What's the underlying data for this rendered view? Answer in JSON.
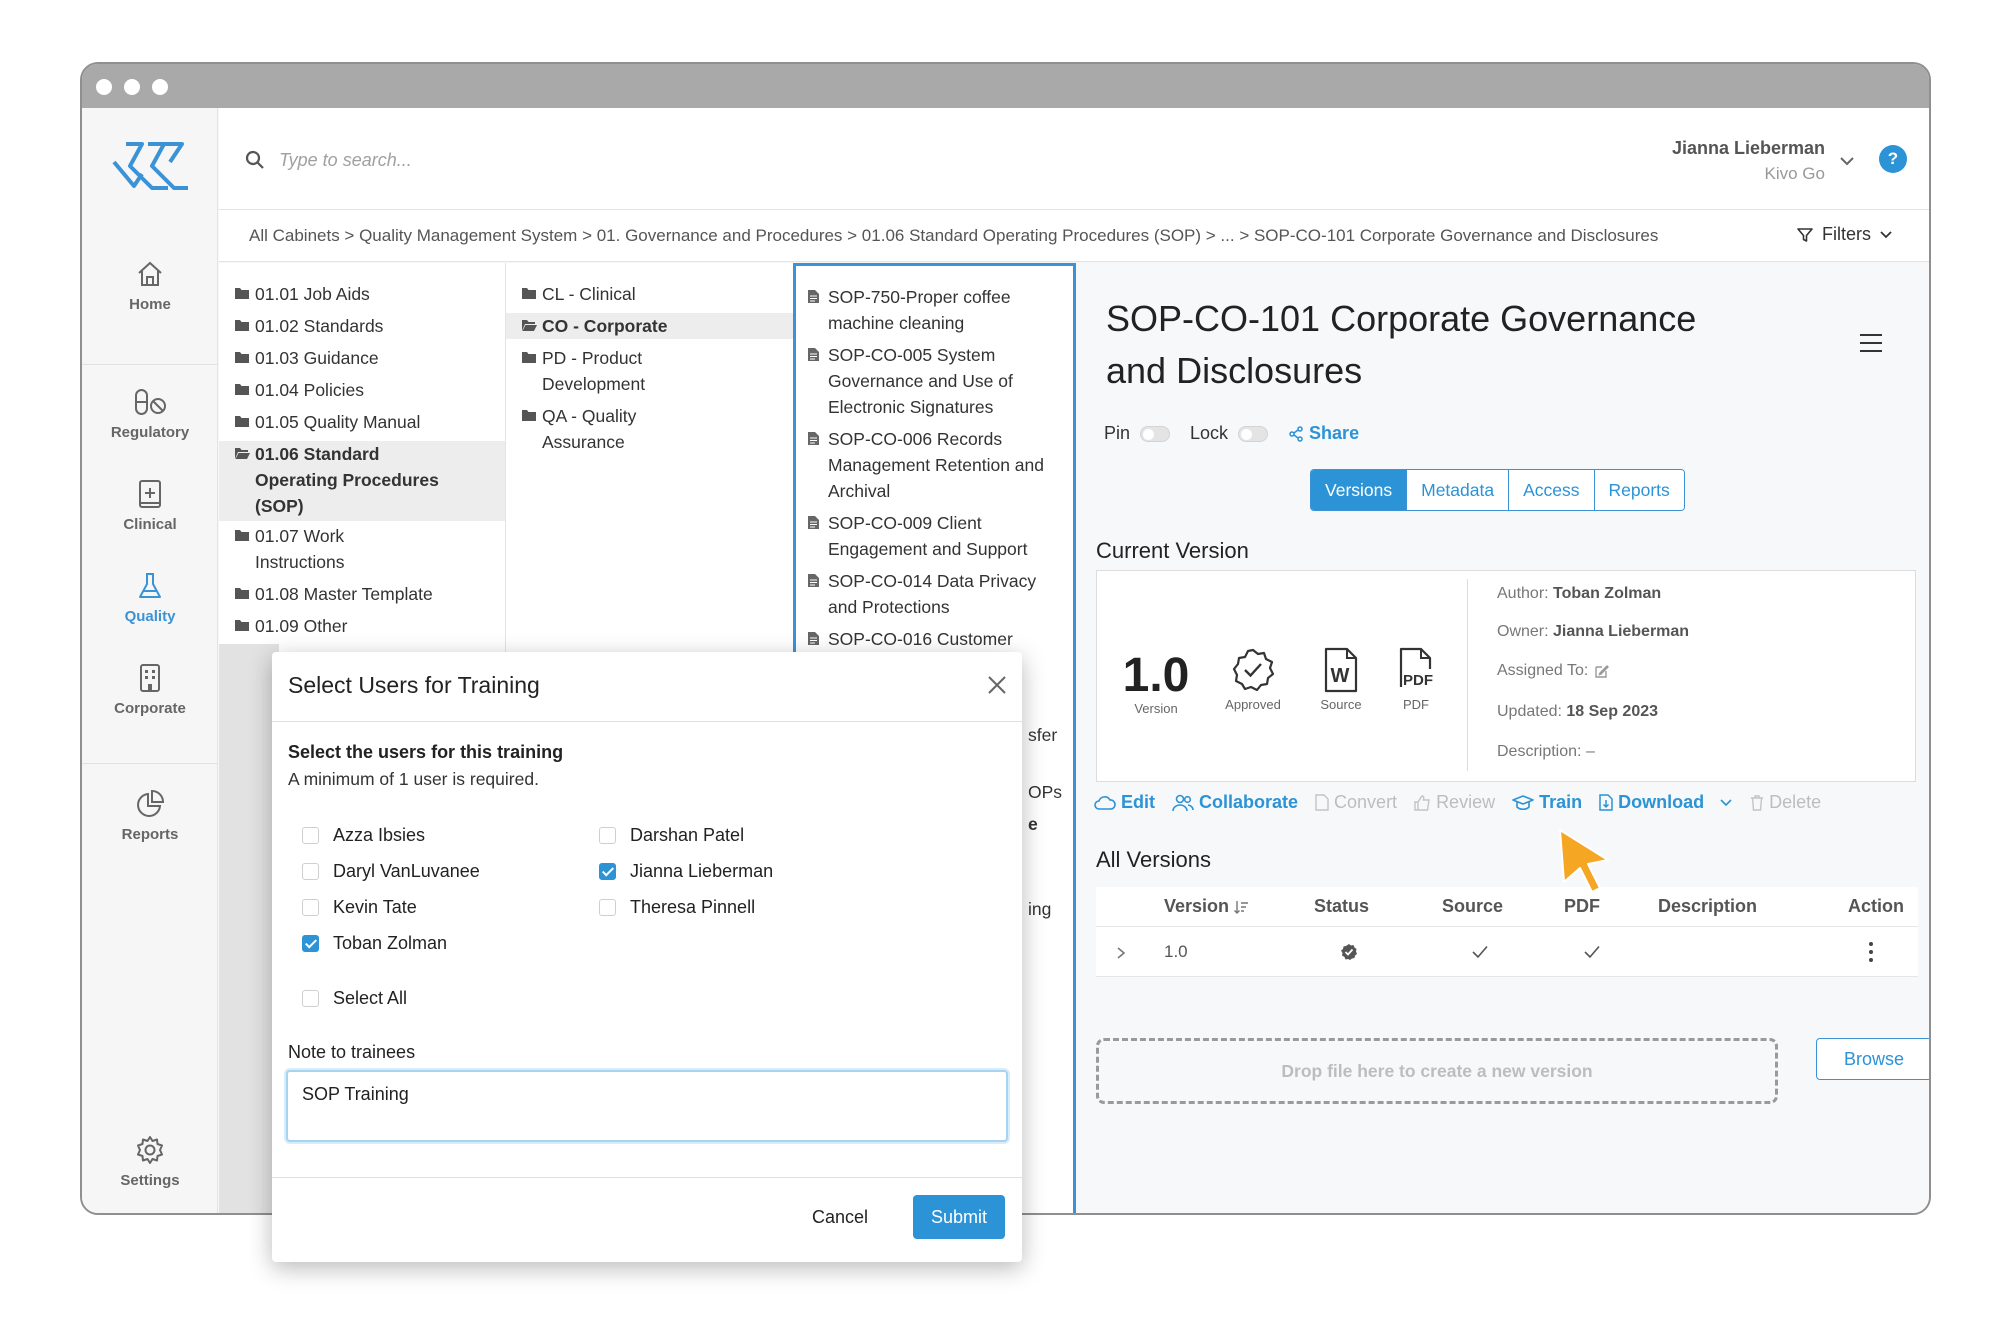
{
  "search": {
    "placeholder": "Type to search..."
  },
  "user": {
    "name": "Jianna Lieberman",
    "org": "Kivo Go",
    "help": "?"
  },
  "sidebar": {
    "items": [
      {
        "label": "Home"
      },
      {
        "label": "Regulatory"
      },
      {
        "label": "Clinical"
      },
      {
        "label": "Quality"
      },
      {
        "label": "Corporate"
      },
      {
        "label": "Reports"
      },
      {
        "label": "Settings"
      }
    ]
  },
  "breadcrumb": "All Cabinets > Quality Management System > 01. Governance and Procedures > 01.06 Standard Operating Procedures (SOP) > ... > SOP-CO-101 Corporate Governance and Disclosures",
  "filters_label": "Filters",
  "col1": [
    {
      "label": "01.01 Job Aids"
    },
    {
      "label": "01.02 Standards"
    },
    {
      "label": "01.03 Guidance"
    },
    {
      "label": "01.04 Policies"
    },
    {
      "label": "01.05 Quality Manual"
    },
    {
      "label": "01.06 Standard Operating Procedures (SOP)"
    },
    {
      "label": "01.07 Work Instructions"
    },
    {
      "label": "01.08 Master Template"
    },
    {
      "label": "01.09 Other"
    }
  ],
  "col2": [
    {
      "label": "CL - Clinical"
    },
    {
      "label": "CO - Corporate"
    },
    {
      "label": "PD - Product Development"
    },
    {
      "label": "QA - Quality Assurance"
    }
  ],
  "col3": [
    {
      "label": "SOP-750-Proper coffee machine cleaning"
    },
    {
      "label": "SOP-CO-005 System Governance and Use of Electronic Signatures"
    },
    {
      "label": "SOP-CO-006 Records Management Retention and Archival"
    },
    {
      "label": "SOP-CO-009 Client Engagement and Support"
    },
    {
      "label": "SOP-CO-014 Data Privacy and Protections"
    },
    {
      "label": "SOP-CO-016 Customer"
    }
  ],
  "col3_fragments": [
    "sfer",
    "OPs",
    "e",
    "ing"
  ],
  "doc": {
    "title": "SOP-CO-101 Corporate Governance and Disclosures",
    "pin_label": "Pin",
    "lock_label": "Lock",
    "share_label": "Share",
    "tabs": [
      {
        "label": "Versions"
      },
      {
        "label": "Metadata"
      },
      {
        "label": "Access"
      },
      {
        "label": "Reports"
      }
    ],
    "current_version_title": "Current Version",
    "version": "1.0",
    "version_label": "Version",
    "status_label": "Approved",
    "source_label": "Source",
    "pdf_label": "PDF",
    "pdf_icon_text": "PDF",
    "word_icon_text": "W",
    "author_key": "Author:",
    "author": "Toban Zolman",
    "owner_key": "Owner:",
    "owner": "Jianna Lieberman",
    "assigned_key": "Assigned To:",
    "updated_key": "Updated:",
    "updated": "18 Sep 2023",
    "description_key": "Description:",
    "description": "–"
  },
  "actions": [
    {
      "label": "Edit"
    },
    {
      "label": "Collaborate"
    },
    {
      "label": "Convert"
    },
    {
      "label": "Review"
    },
    {
      "label": "Train"
    },
    {
      "label": "Download"
    },
    {
      "label": "Delete"
    }
  ],
  "versions": {
    "title": "All Versions",
    "columns": [
      "Version",
      "Status",
      "Source",
      "PDF",
      "Description",
      "Action"
    ],
    "rows": [
      {
        "version": "1.0"
      }
    ]
  },
  "dropzone": "Drop file here to create a new version",
  "browse_label": "Browse",
  "modal": {
    "title": "Select Users for Training",
    "subtitle": "Select the users for this training",
    "hint": "A minimum of 1 user is required.",
    "users": [
      {
        "name": "Azza Ibsies",
        "checked": false
      },
      {
        "name": "Darshan Patel",
        "checked": false
      },
      {
        "name": "Daryl VanLuvanee",
        "checked": false
      },
      {
        "name": "Jianna Lieberman",
        "checked": true
      },
      {
        "name": "Kevin Tate",
        "checked": false
      },
      {
        "name": "Theresa Pinnell",
        "checked": false
      },
      {
        "name": "Toban Zolman",
        "checked": true
      }
    ],
    "select_all": "Select All",
    "note_label": "Note to trainees",
    "note_value": "SOP Training",
    "cancel": "Cancel",
    "submit": "Submit"
  },
  "colors": {
    "accent": "#2b93d6",
    "cursor": "#f5a623"
  }
}
